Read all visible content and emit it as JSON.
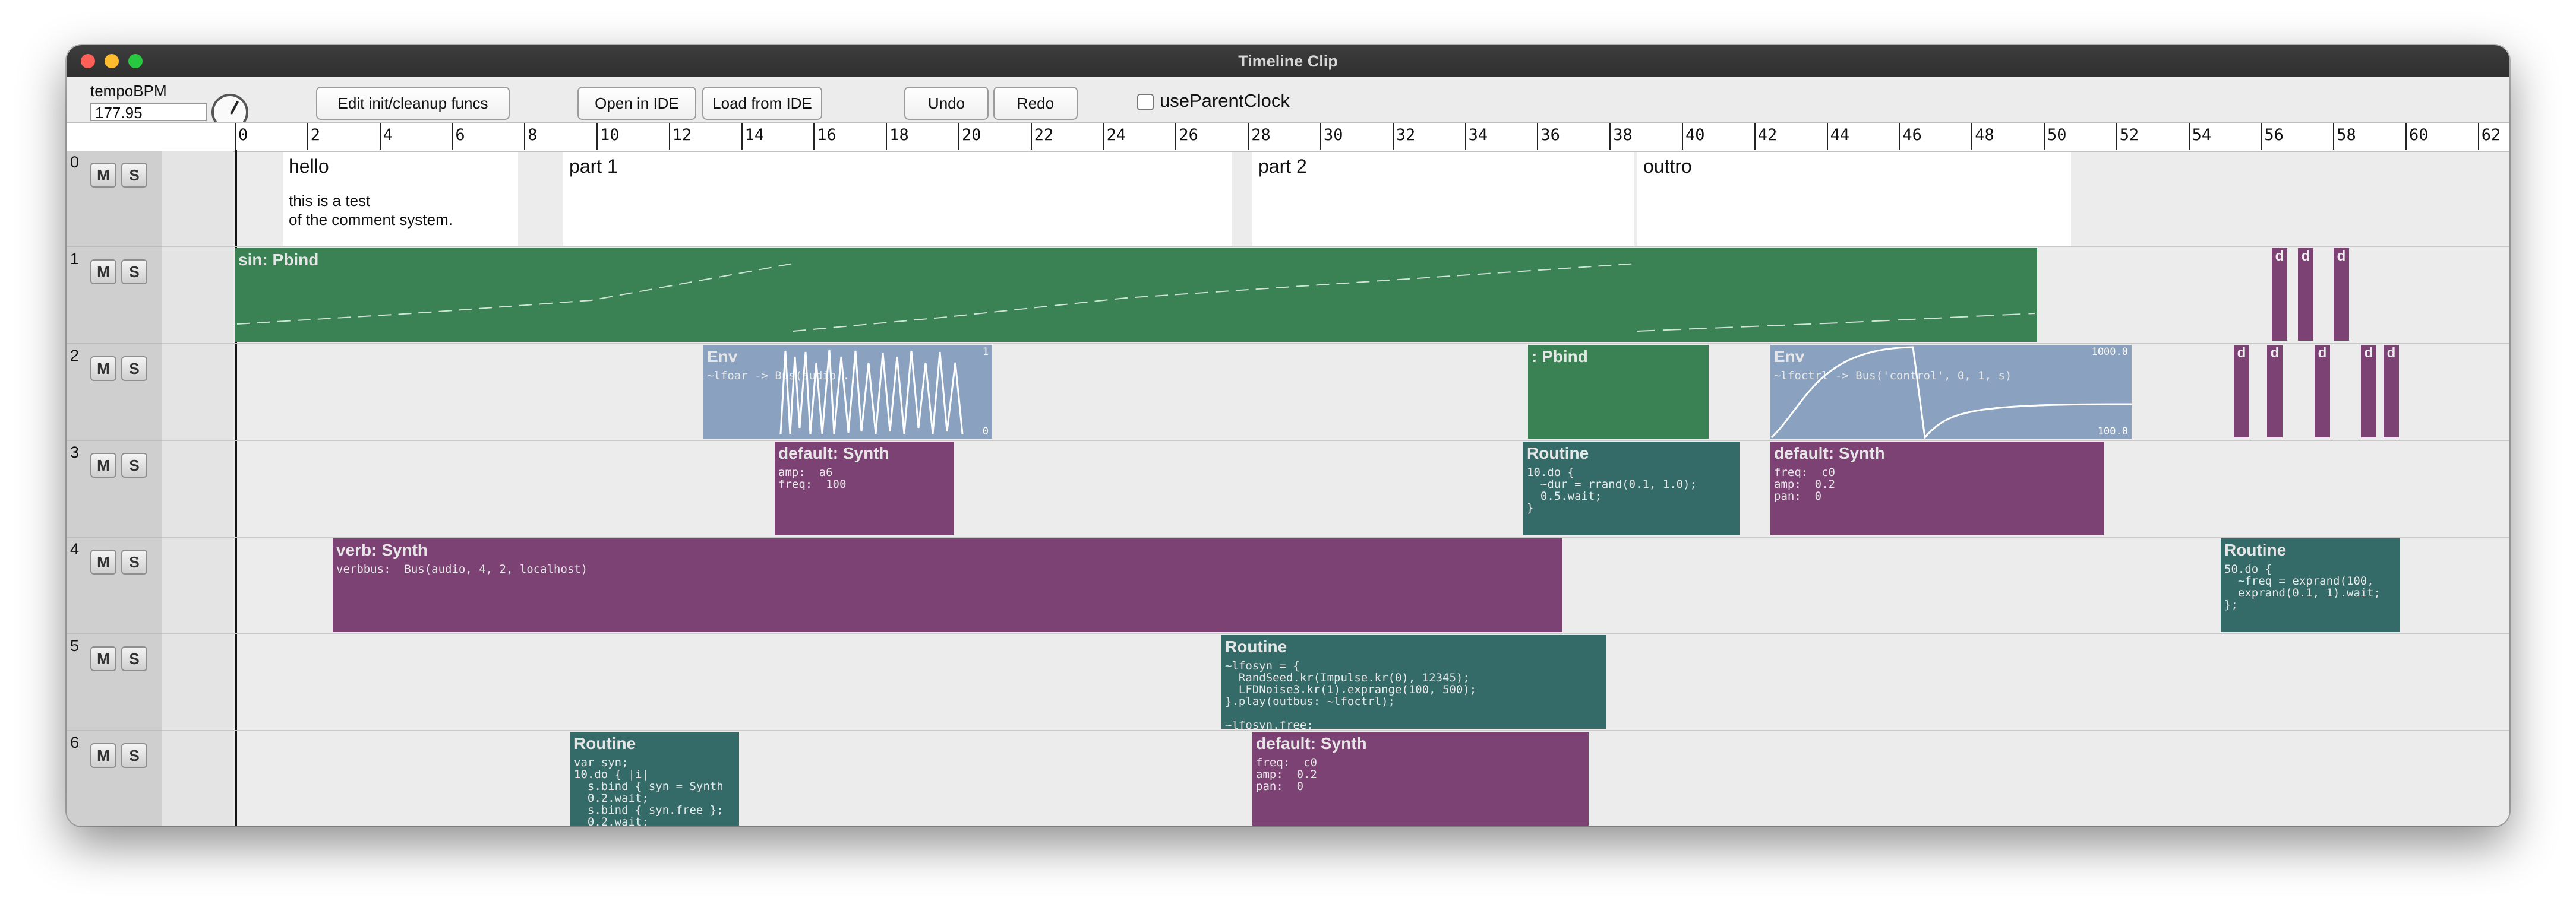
{
  "window": {
    "title": "Timeline Clip"
  },
  "toolbar": {
    "tempo_label": "tempoBPM",
    "tempo_value": "177.95",
    "edit_funcs": "Edit init/cleanup funcs",
    "open_ide": "Open in IDE",
    "load_ide": "Load from IDE",
    "undo": "Undo",
    "redo": "Redo",
    "use_parent_clock": "useParentClock"
  },
  "ruler": {
    "ticks": [
      "0",
      "2",
      "4",
      "6",
      "8",
      "10",
      "12",
      "14",
      "16",
      "18",
      "20",
      "22",
      "24",
      "26",
      "28",
      "30",
      "32",
      "34",
      "36",
      "38",
      "40",
      "42",
      "44",
      "46",
      "48",
      "50",
      "52",
      "54",
      "56",
      "58",
      "60",
      "62"
    ]
  },
  "tracks": [
    {
      "num": "0",
      "mute": "M",
      "solo": "S"
    },
    {
      "num": "1",
      "mute": "M",
      "solo": "S"
    },
    {
      "num": "2",
      "mute": "M",
      "solo": "S"
    },
    {
      "num": "3",
      "mute": "M",
      "solo": "S"
    },
    {
      "num": "4",
      "mute": "M",
      "solo": "S"
    },
    {
      "num": "5",
      "mute": "M",
      "solo": "S"
    },
    {
      "num": "6",
      "mute": "M",
      "solo": "S"
    }
  ],
  "comments": [
    {
      "title": "hello",
      "body": "this is a test\nof the comment system."
    },
    {
      "title": "part 1",
      "body": ""
    },
    {
      "title": "part 2",
      "body": ""
    },
    {
      "title": "outtro",
      "body": ""
    }
  ],
  "clips": {
    "sin_pbind": {
      "title": "sin: Pbind"
    },
    "env1": {
      "title": "Env",
      "code": "~lfoar -> Bus(audio...",
      "max": "1",
      "min": "0"
    },
    "pbind2": {
      "title": ": Pbind"
    },
    "env2": {
      "title": "Env",
      "code": "~lfoctrl -> Bus('control', 0, 1, s)",
      "max": "1000.0",
      "min": "100.0"
    },
    "synth3a": {
      "title": "default: Synth",
      "code": "amp:  a6\nfreq:  100"
    },
    "routine3": {
      "title": "Routine",
      "code": "10.do {\n  ~dur = rrand(0.1, 1.0);\n  0.5.wait;\n}"
    },
    "synth3b": {
      "title": "default: Synth",
      "code": "freq:  c0\namp:  0.2\npan:  0"
    },
    "verb": {
      "title": "verb: Synth",
      "code": "verbbus:  Bus(audio, 4, 2, localhost)"
    },
    "routine4": {
      "title": "Routine",
      "code": "50.do {\n  ~freq = exprand(100,\n  exprand(0.1, 1).wait;\n};"
    },
    "routine5": {
      "title": "Routine",
      "code": "~lfosyn = {\n  RandSeed.kr(Impulse.kr(0), 12345);\n  LFDNoise3.kr(1).exprange(100, 500);\n}.play(outbus: ~lfoctrl);\n\n~lfosyn.free;"
    },
    "routine6": {
      "title": "Routine",
      "code": "var syn;\n10.do { |i|\n  s.bind { syn = Synth\n  0.2.wait;\n  s.bind { syn.free };\n  0.2.wait;"
    },
    "synth6": {
      "title": "default: Synth",
      "code": "freq:  c0\namp:  0.2\npan:  0"
    },
    "d_label": "d"
  }
}
